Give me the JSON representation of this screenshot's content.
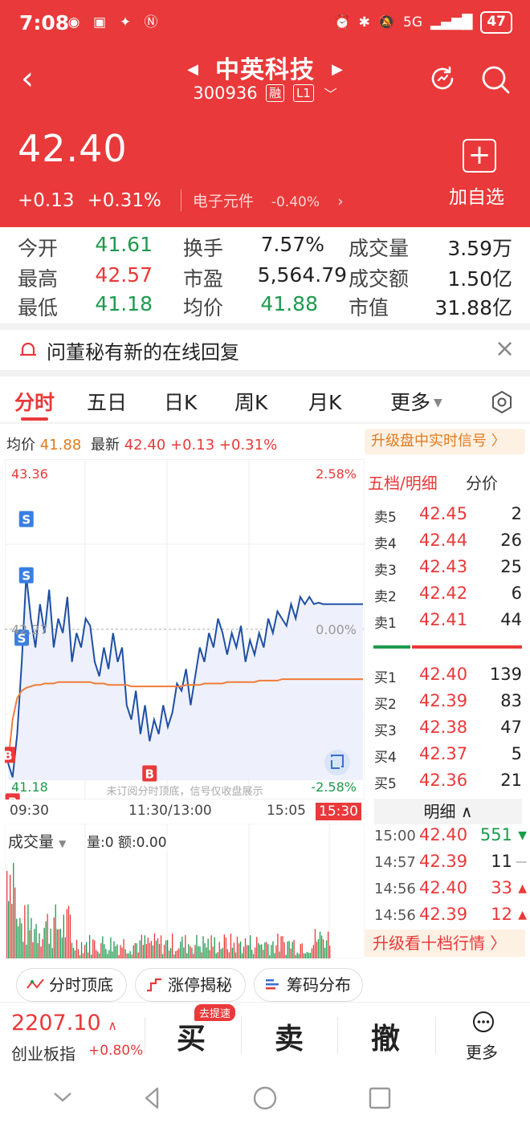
{
  "status": {
    "time": "7:08",
    "signal": "5G",
    "battery": "47"
  },
  "stock": {
    "name": "中英科技",
    "code": "300936",
    "tag_margin": "融",
    "tag_level": "L1"
  },
  "quote": {
    "price": "42.40",
    "change": "+0.13",
    "change_pct": "+0.31%",
    "sector": "电子元件",
    "sector_pct": "-0.40%",
    "add_fav_label": "加自选"
  },
  "stats": [
    {
      "l1": "今开",
      "v1": "41.61",
      "l2": "换手",
      "v2": "7.57%",
      "l3": "成交量",
      "v3": "3.59万"
    },
    {
      "l1": "最高",
      "v1": "42.57",
      "l2": "市盈",
      "v2": "5,564.79",
      "l3": "成交额",
      "v3": "1.50亿"
    },
    {
      "l1": "最低",
      "v1": "41.18",
      "l2": "均价",
      "v2": "41.88",
      "l3": "市值",
      "v3": "31.88亿"
    }
  ],
  "notice": {
    "text": "问董秘有新的在线回复"
  },
  "tabs": [
    "分时",
    "五日",
    "日K",
    "周K",
    "月K",
    "更多"
  ],
  "avg_row": {
    "avg_label": "均价",
    "avg": "41.88",
    "latest_label": "最新",
    "latest": "42.40",
    "chg": "+0.13",
    "pct": "+0.31%",
    "upgrade": "升级盘中实时信号 〉"
  },
  "chart_data": {
    "type": "line",
    "y_max_label": "43.36",
    "y_max_pct": "2.58%",
    "y_ref_label": "42.27",
    "y_ref_pct": "0.00%",
    "y_min_label": "41.18",
    "y_min_pct": "-2.58%",
    "ylim": [
      41.18,
      43.36
    ],
    "time_labels": [
      "09:30",
      "11:30/13:00",
      "15:05",
      "15:30"
    ],
    "watermark": "未订阅分时顶底，信号仅收盘展示",
    "series": [
      {
        "name": "最新",
        "color": "#1f4fa3",
        "values": [
          41.3,
          41.2,
          41.5,
          42.0,
          42.6,
          42.3,
          42.1,
          42.4,
          42.2,
          42.5,
          42.1,
          42.3,
          42.2,
          42.45,
          42.0,
          42.2,
          42.1,
          42.3,
          42.25,
          42.0,
          41.9,
          42.1,
          41.95,
          42.2,
          42.0,
          42.1,
          41.7,
          41.6,
          41.8,
          41.5,
          41.7,
          41.45,
          41.6,
          41.5,
          41.7,
          41.55,
          41.65,
          41.85,
          41.8,
          41.95,
          41.7,
          41.9,
          42.1,
          42.0,
          42.2,
          42.1,
          42.3,
          42.2,
          42.05,
          42.2,
          42.1,
          42.25,
          42.0,
          42.15,
          42.05,
          42.2,
          42.1,
          42.3,
          42.2,
          42.35,
          42.3,
          42.25,
          42.4,
          42.3,
          42.45,
          42.4,
          42.45,
          42.4,
          42.41,
          42.4,
          42.4
        ]
      },
      {
        "name": "均价",
        "color": "#f07c39",
        "values": [
          41.3,
          41.6,
          41.75,
          41.8,
          41.82,
          41.83,
          41.84,
          41.84,
          41.85,
          41.85,
          41.85,
          41.86,
          41.86,
          41.86,
          41.86,
          41.86,
          41.86,
          41.86,
          41.86,
          41.85,
          41.85,
          41.85,
          41.84,
          41.84,
          41.84,
          41.84,
          41.84,
          41.83,
          41.83,
          41.83,
          41.83,
          41.83,
          41.83,
          41.83,
          41.83,
          41.83,
          41.83,
          41.83,
          41.83,
          41.84,
          41.84,
          41.84,
          41.84,
          41.85,
          41.85,
          41.85,
          41.85,
          41.85,
          41.86,
          41.86,
          41.86,
          41.86,
          41.86,
          41.86,
          41.86,
          41.87,
          41.87,
          41.87,
          41.87,
          41.87,
          41.88,
          41.88,
          41.88,
          41.88,
          41.88,
          41.88,
          41.88,
          41.88,
          41.88,
          41.88,
          41.88
        ]
      }
    ],
    "signals": [
      {
        "label": "S"
      },
      {
        "label": "S"
      },
      {
        "label": "S"
      },
      {
        "label": "B"
      },
      {
        "label": "B"
      },
      {
        "label": "B"
      }
    ]
  },
  "volume": {
    "label": "成交量",
    "info": "量:0 额:0.00"
  },
  "book": {
    "head1": "五档/明细",
    "head2": "分价",
    "asks": [
      {
        "l": "卖5",
        "p": "42.45",
        "v": "2"
      },
      {
        "l": "卖4",
        "p": "42.44",
        "v": "26"
      },
      {
        "l": "卖3",
        "p": "42.43",
        "v": "25"
      },
      {
        "l": "卖2",
        "p": "42.42",
        "v": "6"
      },
      {
        "l": "卖1",
        "p": "42.41",
        "v": "44"
      }
    ],
    "bids": [
      {
        "l": "买1",
        "p": "42.40",
        "v": "139"
      },
      {
        "l": "买2",
        "p": "42.39",
        "v": "83"
      },
      {
        "l": "买3",
        "p": "42.38",
        "v": "47"
      },
      {
        "l": "买4",
        "p": "42.37",
        "v": "5"
      },
      {
        "l": "买5",
        "p": "42.36",
        "v": "21"
      }
    ],
    "detail_label": "明细 ∧",
    "ticks": [
      {
        "t": "15:00",
        "p": "42.40",
        "v": "551",
        "dir": "down",
        "vcolor": "#1e9a4d"
      },
      {
        "t": "14:57",
        "p": "42.39",
        "v": "11",
        "dir": "flat",
        "vcolor": "#222222"
      },
      {
        "t": "14:56",
        "p": "42.40",
        "v": "33",
        "dir": "up",
        "vcolor": "#e9393a"
      },
      {
        "t": "14:56",
        "p": "42.39",
        "v": "12",
        "dir": "up",
        "vcolor": "#e9393a"
      }
    ],
    "upgrade": "升级看十档行情 〉"
  },
  "tools": [
    "分时顶底",
    "涨停揭秘",
    "筹码分布"
  ],
  "bottom": {
    "index_val": "2207.10",
    "index_name": "创业板指",
    "index_pct": "+0.80%",
    "buy": "买",
    "sell": "卖",
    "cancel": "撤",
    "speed_badge": "去提速",
    "more": "更多"
  }
}
